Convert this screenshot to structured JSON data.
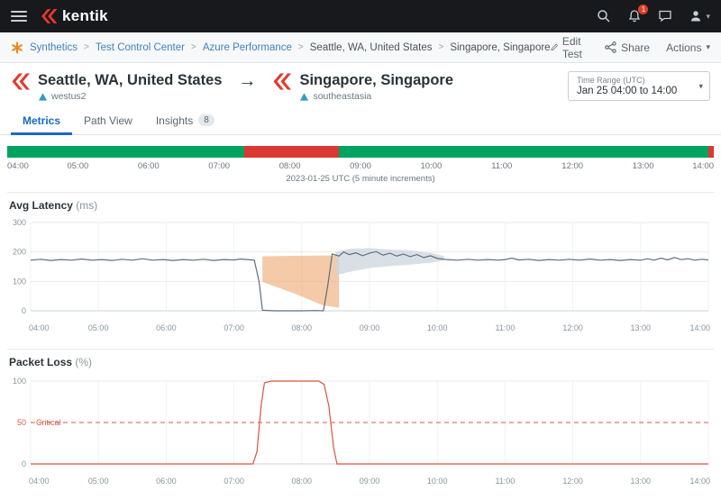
{
  "header": {
    "brand": "kentik",
    "notification_count": "1"
  },
  "breadcrumb": {
    "items": [
      {
        "label": "Synthetics",
        "link": true
      },
      {
        "label": "Test Control Center",
        "link": true
      },
      {
        "label": "Azure Performance",
        "link": true
      },
      {
        "label": "Seattle, WA, United States",
        "link": false
      },
      {
        "label": "Singapore, Singapore",
        "link": false
      }
    ]
  },
  "toolbar": {
    "edit": "Edit Test",
    "share": "Share",
    "actions": "Actions"
  },
  "comparison": {
    "source": {
      "name": "Seattle, WA, United States",
      "region": "westus2"
    },
    "destination": {
      "name": "Singapore, Singapore",
      "region": "southeastasia"
    },
    "arrow": "→"
  },
  "time_range": {
    "label": "Time Range (UTC)",
    "value": "Jan 25 04:00 to 14:00"
  },
  "tabs": [
    {
      "label": "Metrics",
      "active": true
    },
    {
      "label": "Path View",
      "active": false
    },
    {
      "label": "Insights",
      "active": false,
      "badge": "8"
    }
  ],
  "timeline": {
    "caption": "2023-01-25 UTC (5 minute increments)",
    "ticks": [
      "04:00",
      "05:00",
      "06:00",
      "07:00",
      "08:00",
      "09:00",
      "10:00",
      "11:00",
      "12:00",
      "13:00",
      "14:00"
    ],
    "colors": {
      "healthy": "#00a35f",
      "critical": "#da3832"
    },
    "segments": [
      {
        "status": "healthy",
        "color": "#00a35f",
        "from_pct": 0,
        "to_pct": 33.6
      },
      {
        "status": "critical",
        "color": "#da3832",
        "from_pct": 33.6,
        "to_pct": 46.9
      },
      {
        "status": "healthy",
        "color": "#00a35f",
        "from_pct": 46.9,
        "to_pct": 99.2
      },
      {
        "status": "critical",
        "color": "#da3832",
        "from_pct": 99.2,
        "to_pct": 100
      }
    ]
  },
  "chart_data": [
    {
      "type": "line",
      "title": "Avg Latency",
      "unit": "(ms)",
      "x_range": [
        4,
        14
      ],
      "x_tick_labels": [
        "04:00",
        "05:00",
        "06:00",
        "07:00",
        "08:00",
        "09:00",
        "10:00",
        "11:00",
        "12:00",
        "13:00",
        "14:00"
      ],
      "ylim": [
        0,
        300
      ],
      "yticks": [
        0,
        100,
        200,
        300
      ],
      "line_color": "#5f6e7c",
      "grid": true,
      "legend": "none",
      "series": [
        {
          "name": "avg-latency-ms",
          "points": [
            [
              4.0,
              172
            ],
            [
              4.15,
              175
            ],
            [
              4.3,
              171
            ],
            [
              4.45,
              174
            ],
            [
              4.6,
              172
            ],
            [
              4.75,
              176
            ],
            [
              4.9,
              172
            ],
            [
              5.05,
              174
            ],
            [
              5.2,
              171
            ],
            [
              5.35,
              175
            ],
            [
              5.5,
              172
            ],
            [
              5.65,
              177
            ],
            [
              5.8,
              172
            ],
            [
              5.95,
              174
            ],
            [
              6.1,
              171
            ],
            [
              6.25,
              174
            ],
            [
              6.4,
              172
            ],
            [
              6.55,
              175
            ],
            [
              6.7,
              171
            ],
            [
              6.85,
              174
            ],
            [
              7.0,
              173
            ],
            [
              7.1,
              176
            ],
            [
              7.2,
              174
            ],
            [
              7.3,
              172
            ],
            [
              7.37,
              100
            ],
            [
              7.42,
              2
            ],
            [
              7.6,
              0
            ],
            [
              7.8,
              0
            ],
            [
              8.0,
              0
            ],
            [
              8.2,
              1
            ],
            [
              8.32,
              0
            ],
            [
              8.38,
              80
            ],
            [
              8.45,
              193
            ],
            [
              8.55,
              186
            ],
            [
              8.62,
              200
            ],
            [
              8.7,
              191
            ],
            [
              8.8,
              197
            ],
            [
              8.9,
              187
            ],
            [
              9.0,
              196
            ],
            [
              9.1,
              201
            ],
            [
              9.2,
              189
            ],
            [
              9.3,
              196
            ],
            [
              9.4,
              186
            ],
            [
              9.5,
              193
            ],
            [
              9.6,
              184
            ],
            [
              9.7,
              191
            ],
            [
              9.8,
              181
            ],
            [
              9.9,
              187
            ],
            [
              10.0,
              178
            ],
            [
              10.15,
              174
            ],
            [
              10.3,
              172
            ],
            [
              10.45,
              175
            ],
            [
              10.6,
              172
            ],
            [
              10.75,
              174
            ],
            [
              10.9,
              172
            ],
            [
              11.0,
              174
            ],
            [
              11.1,
              179
            ],
            [
              11.2,
              173
            ],
            [
              11.35,
              175
            ],
            [
              11.5,
              171
            ],
            [
              11.65,
              174
            ],
            [
              11.8,
              172
            ],
            [
              11.95,
              175
            ],
            [
              12.1,
              172
            ],
            [
              12.25,
              176
            ],
            [
              12.4,
              172
            ],
            [
              12.55,
              174
            ],
            [
              12.7,
              171
            ],
            [
              12.85,
              174
            ],
            [
              13.0,
              172
            ],
            [
              13.1,
              177
            ],
            [
              13.2,
              172
            ],
            [
              13.3,
              179
            ],
            [
              13.4,
              173
            ],
            [
              13.5,
              181
            ],
            [
              13.6,
              174
            ],
            [
              13.7,
              177
            ],
            [
              13.8,
              172
            ],
            [
              13.9,
              175
            ],
            [
              14.0,
              173
            ]
          ]
        }
      ],
      "bands": [
        {
          "name": "anomaly-band-orange",
          "color": "#f0b383",
          "opacity": 0.7,
          "top": [
            [
              7.42,
              185
            ],
            [
              7.9,
              187
            ],
            [
              8.3,
              188
            ],
            [
              8.55,
              188
            ]
          ],
          "bottom": [
            [
              7.42,
              98
            ],
            [
              7.9,
              58
            ],
            [
              8.3,
              20
            ],
            [
              8.55,
              10
            ]
          ]
        },
        {
          "name": "confidence-band-gray",
          "color": "#ccd5dc",
          "opacity": 0.75,
          "top": [
            [
              8.5,
              200
            ],
            [
              8.7,
              211
            ],
            [
              9.0,
              213
            ],
            [
              9.3,
              208
            ],
            [
              9.6,
              205
            ],
            [
              9.9,
              197
            ],
            [
              10.1,
              186
            ]
          ],
          "bottom": [
            [
              8.5,
              120
            ],
            [
              8.7,
              132
            ],
            [
              9.0,
              145
            ],
            [
              9.3,
              152
            ],
            [
              9.6,
              157
            ],
            [
              9.9,
              163
            ],
            [
              10.1,
              170
            ]
          ]
        }
      ]
    },
    {
      "type": "line",
      "title": "Packet Loss",
      "unit": "(%)",
      "x_range": [
        4,
        14
      ],
      "x_tick_labels": [
        "04:00",
        "05:00",
        "06:00",
        "07:00",
        "08:00",
        "09:00",
        "10:00",
        "11:00",
        "12:00",
        "13:00",
        "14:00"
      ],
      "ylim": [
        0,
        100
      ],
      "yticks": [
        0,
        100
      ],
      "line_color": "#e0523f",
      "grid": true,
      "legend": "none",
      "threshold": {
        "value": 50,
        "label": "50",
        "annotation": "Critical",
        "color": "#d65a4e"
      },
      "series": [
        {
          "name": "packet-loss-pct",
          "points": [
            [
              4,
              0
            ],
            [
              5,
              0
            ],
            [
              6,
              0
            ],
            [
              7,
              0
            ],
            [
              7.28,
              0
            ],
            [
              7.34,
              15
            ],
            [
              7.4,
              70
            ],
            [
              7.45,
              98
            ],
            [
              7.55,
              100
            ],
            [
              7.8,
              100
            ],
            [
              8.1,
              100
            ],
            [
              8.25,
              100
            ],
            [
              8.33,
              96
            ],
            [
              8.4,
              70
            ],
            [
              8.47,
              20
            ],
            [
              8.52,
              0
            ],
            [
              9,
              0
            ],
            [
              10,
              0
            ],
            [
              11,
              0
            ],
            [
              12,
              0
            ],
            [
              13,
              0
            ],
            [
              14,
              0
            ]
          ]
        }
      ]
    }
  ]
}
